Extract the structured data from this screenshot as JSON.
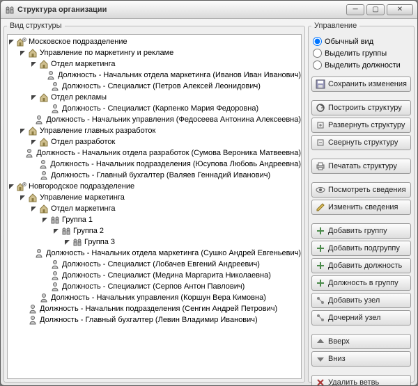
{
  "window": {
    "title": "Структура организации"
  },
  "panels": {
    "left_legend": "Вид структуры",
    "right_legend": "Управление"
  },
  "radios": {
    "normal": "Обычный вид",
    "groups": "Выделить группы",
    "positions": "Выделить должности",
    "selected": "normal"
  },
  "buttons": {
    "save": "Сохранить изменения",
    "build": "Построить структуру",
    "expand": "Развернуть структуру",
    "collapse": "Свернуть структуру",
    "print": "Печатать структуру",
    "view_details": "Посмотреть сведения",
    "edit_details": "Изменить сведения",
    "add_group": "Добавить группу",
    "add_subgroup": "Добавить подгруппу",
    "add_position": "Добавить должность",
    "position_to_group": "Должность в группу",
    "add_node": "Добавить узел",
    "child_node": "Дочерний узел",
    "up": "Вверх",
    "down": "Вниз",
    "delete_branch": "Удалить ветвь"
  },
  "tree": [
    {
      "icon": "org",
      "label": "Московское подразделение",
      "expanded": true,
      "children": [
        {
          "icon": "dept",
          "label": "Управление по маркетингу и рекламе",
          "expanded": true,
          "children": [
            {
              "icon": "dept",
              "label": "Отдел маркетинга",
              "expanded": true,
              "children": [
                {
                  "icon": "pos",
                  "label": "Должность - Начальник отдела маркетинга (Иванов Иван Иванович)"
                },
                {
                  "icon": "pos",
                  "label": "Должность - Специалист (Петров Алексей Леонидович)"
                }
              ]
            },
            {
              "icon": "dept",
              "label": "Отдел рекламы",
              "expanded": true,
              "children": [
                {
                  "icon": "pos",
                  "label": "Должность - Специалист (Карпенко Мария Федоровна)"
                },
                {
                  "icon": "pos",
                  "label": "Должность - Начальник управления (Федосеева Антонина Алексеевна)"
                }
              ]
            }
          ]
        },
        {
          "icon": "dept",
          "label": "Управление главных разработок",
          "expanded": true,
          "children": [
            {
              "icon": "dept",
              "label": "Отдел разработок",
              "expanded": true,
              "children": [
                {
                  "icon": "pos",
                  "label": "Должность - Начальник отдела разработок (Сумова Вероника Матвеевна)"
                }
              ]
            },
            {
              "icon": "pos",
              "label": "Должность - Начальник подразделения (Юсупова Любовь Андреевна)"
            },
            {
              "icon": "pos",
              "label": "Должность - Главный бухгалтер (Валяев Геннадий Иванович)"
            }
          ]
        }
      ]
    },
    {
      "icon": "org",
      "label": "Новгородское подразделение",
      "expanded": true,
      "children": [
        {
          "icon": "dept",
          "label": "Управление маркетинга",
          "expanded": true,
          "children": [
            {
              "icon": "dept",
              "label": "Отдел маркетинга",
              "expanded": true,
              "children": [
                {
                  "icon": "grp",
                  "label": "Группа 1",
                  "expanded": true,
                  "children": [
                    {
                      "icon": "grp",
                      "label": "Группа 2",
                      "expanded": true,
                      "children": [
                        {
                          "icon": "grp",
                          "label": "Группа 3",
                          "expanded": true,
                          "children": [
                            {
                              "icon": "pos",
                              "label": "Должность - Начальник отдела маркетинга (Сушко Андрей Евгеньевич)"
                            }
                          ]
                        }
                      ]
                    }
                  ]
                },
                {
                  "icon": "pos",
                  "label": "Должность - Специалист (Лобачев Евгений Андреевич)"
                },
                {
                  "icon": "pos",
                  "label": "Должность - Специалист (Медина Маргарита Николаевна)"
                },
                {
                  "icon": "pos",
                  "label": "Должность - Специалист (Серпов Антон Павлович)"
                }
              ]
            },
            {
              "icon": "pos",
              "label": "Должность - Начальник управления (Коршун Вера Кимовна)"
            }
          ]
        },
        {
          "icon": "pos",
          "label": "Должность - Начальник подразделения (Сенгин Андрей Петрович)"
        },
        {
          "icon": "pos",
          "label": "Должность - Главный бухгалтер (Левин Владимир Иванович)"
        }
      ]
    }
  ]
}
